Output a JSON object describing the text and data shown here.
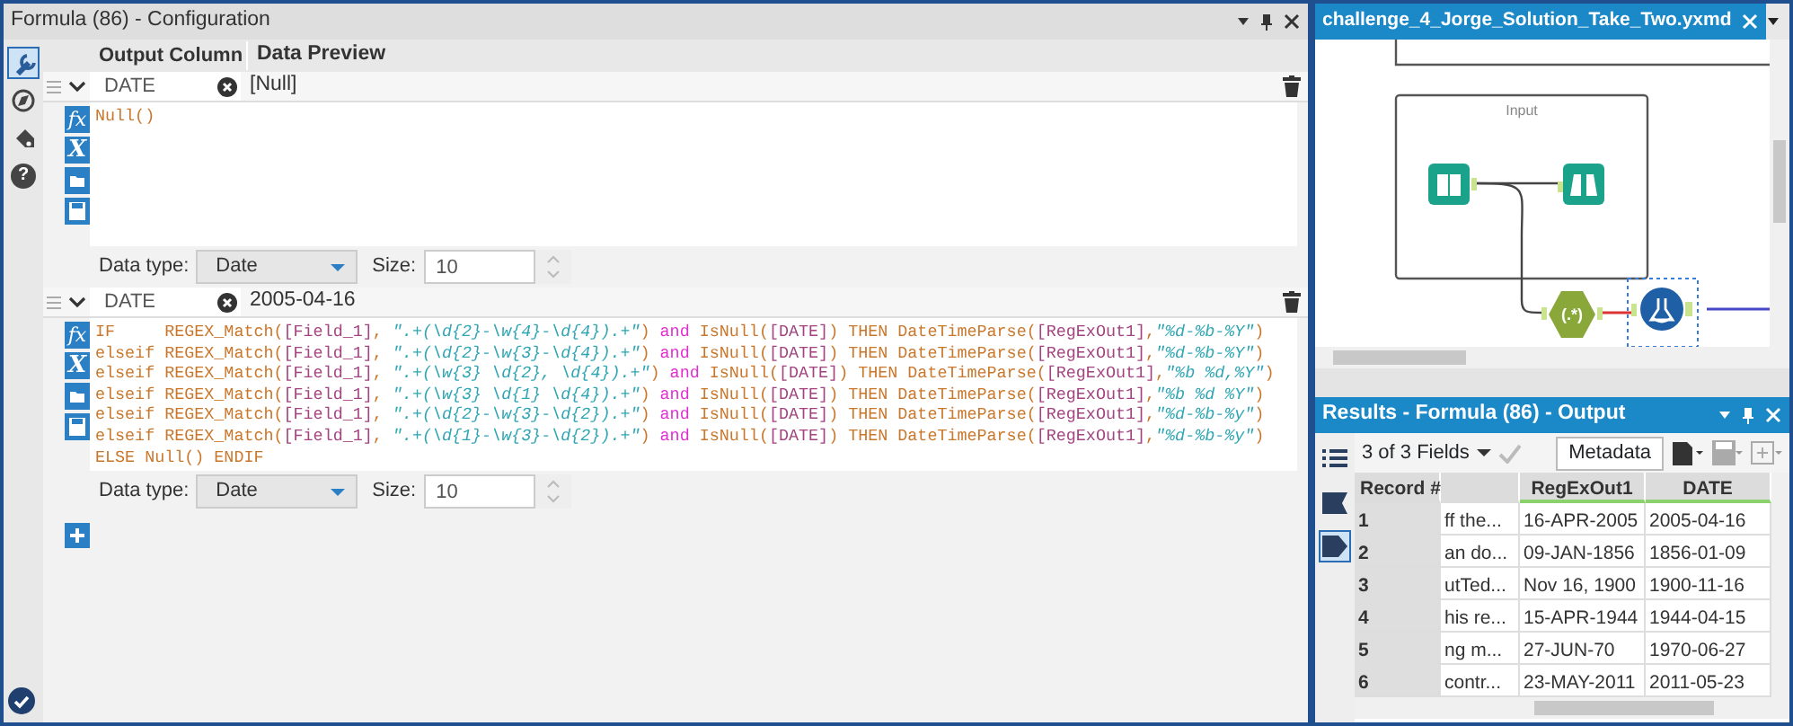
{
  "config_panel": {
    "title": "Formula (86) - Configuration",
    "tools": [
      {
        "kind": "wrench",
        "selected": true
      },
      {
        "kind": "compass",
        "selected": false
      },
      {
        "kind": "tag",
        "selected": false
      },
      {
        "kind": "help",
        "label": "?",
        "selected": false
      }
    ],
    "columns": [
      "Output Column",
      "Data Preview"
    ],
    "expressions": [
      {
        "expanded": true,
        "output_column": "DATE",
        "preview": "[Null]",
        "editor_buttons": [
          {
            "kind": "text",
            "label": "fx"
          },
          {
            "kind": "text",
            "label": "X"
          },
          {
            "kind": "folder"
          },
          {
            "kind": "save"
          }
        ],
        "lines": [
          [
            {
              "kind": "keyword",
              "text": "Null()"
            }
          ]
        ],
        "data_type_label": "Data type:",
        "data_type": "Date",
        "size_label": "Size:",
        "size": "10"
      },
      {
        "expanded": true,
        "output_column": "DATE",
        "preview": "2005-04-16",
        "editor_buttons": [
          {
            "kind": "text",
            "label": "fx"
          },
          {
            "kind": "text",
            "label": "X"
          },
          {
            "kind": "folder"
          },
          {
            "kind": "save"
          }
        ],
        "lines": [
          [
            {
              "kind": "keyword",
              "text": "IF     REGEX_Match("
            },
            {
              "kind": "field",
              "text": "[Field_1]"
            },
            {
              "kind": "keyword",
              "text": ", "
            },
            {
              "kind": "string",
              "text": "\".+(\\d{2}-\\w{4}-\\d{4}).+\""
            },
            {
              "kind": "keyword",
              "text": ")"
            },
            {
              "kind": "operator",
              "text": " and "
            },
            {
              "kind": "keyword",
              "text": "IsNull("
            },
            {
              "kind": "field",
              "text": "[DATE]"
            },
            {
              "kind": "keyword",
              "text": ") THEN DateTimeParse("
            },
            {
              "kind": "field",
              "text": "[RegExOut1]"
            },
            {
              "kind": "keyword",
              "text": ","
            },
            {
              "kind": "string",
              "text": "\"%d-%b-%Y\""
            },
            {
              "kind": "keyword",
              "text": ")"
            }
          ],
          [
            {
              "kind": "keyword",
              "text": "elseif REGEX_Match("
            },
            {
              "kind": "field",
              "text": "[Field_1]"
            },
            {
              "kind": "keyword",
              "text": ", "
            },
            {
              "kind": "string",
              "text": "\".+(\\d{2}-\\w{3}-\\d{4}).+\""
            },
            {
              "kind": "keyword",
              "text": ")"
            },
            {
              "kind": "operator",
              "text": " and "
            },
            {
              "kind": "keyword",
              "text": "IsNull("
            },
            {
              "kind": "field",
              "text": "[DATE]"
            },
            {
              "kind": "keyword",
              "text": ") THEN DateTimeParse("
            },
            {
              "kind": "field",
              "text": "[RegExOut1]"
            },
            {
              "kind": "keyword",
              "text": ","
            },
            {
              "kind": "string",
              "text": "\"%d-%b-%Y\""
            },
            {
              "kind": "keyword",
              "text": ")"
            }
          ],
          [
            {
              "kind": "keyword",
              "text": "elseif REGEX_Match("
            },
            {
              "kind": "field",
              "text": "[Field_1]"
            },
            {
              "kind": "keyword",
              "text": ", "
            },
            {
              "kind": "string",
              "text": "\".+(\\w{3} \\d{2}, \\d{4}).+\""
            },
            {
              "kind": "keyword",
              "text": ")"
            },
            {
              "kind": "operator",
              "text": " and "
            },
            {
              "kind": "keyword",
              "text": "IsNull("
            },
            {
              "kind": "field",
              "text": "[DATE]"
            },
            {
              "kind": "keyword",
              "text": ") THEN DateTimeParse("
            },
            {
              "kind": "field",
              "text": "[RegExOut1]"
            },
            {
              "kind": "keyword",
              "text": ","
            },
            {
              "kind": "string",
              "text": "\"%b %d,%Y\""
            },
            {
              "kind": "keyword",
              "text": ")"
            }
          ],
          [
            {
              "kind": "keyword",
              "text": "elseif REGEX_Match("
            },
            {
              "kind": "field",
              "text": "[Field_1]"
            },
            {
              "kind": "keyword",
              "text": ", "
            },
            {
              "kind": "string",
              "text": "\".+(\\w{3} \\d{1} \\d{4}).+\""
            },
            {
              "kind": "keyword",
              "text": ")"
            },
            {
              "kind": "operator",
              "text": " and "
            },
            {
              "kind": "keyword",
              "text": "IsNull("
            },
            {
              "kind": "field",
              "text": "[DATE]"
            },
            {
              "kind": "keyword",
              "text": ") THEN DateTimeParse("
            },
            {
              "kind": "field",
              "text": "[RegExOut1]"
            },
            {
              "kind": "keyword",
              "text": ","
            },
            {
              "kind": "string",
              "text": "\"%b %d %Y\""
            },
            {
              "kind": "keyword",
              "text": ")"
            }
          ],
          [
            {
              "kind": "keyword",
              "text": "elseif REGEX_Match("
            },
            {
              "kind": "field",
              "text": "[Field_1]"
            },
            {
              "kind": "keyword",
              "text": ", "
            },
            {
              "kind": "string",
              "text": "\".+(\\d{2}-\\w{3}-\\d{2}).+\""
            },
            {
              "kind": "keyword",
              "text": ")"
            },
            {
              "kind": "operator",
              "text": " and "
            },
            {
              "kind": "keyword",
              "text": "IsNull("
            },
            {
              "kind": "field",
              "text": "[DATE]"
            },
            {
              "kind": "keyword",
              "text": ") THEN DateTimeParse("
            },
            {
              "kind": "field",
              "text": "[RegExOut1]"
            },
            {
              "kind": "keyword",
              "text": ","
            },
            {
              "kind": "string",
              "text": "\"%d-%b-%y\""
            },
            {
              "kind": "keyword",
              "text": ")"
            }
          ],
          [
            {
              "kind": "keyword",
              "text": "elseif REGEX_Match("
            },
            {
              "kind": "field",
              "text": "[Field_1]"
            },
            {
              "kind": "keyword",
              "text": ", "
            },
            {
              "kind": "string",
              "text": "\".+(\\d{1}-\\w{3}-\\d{2}).+\""
            },
            {
              "kind": "keyword",
              "text": ")"
            },
            {
              "kind": "operator",
              "text": " and "
            },
            {
              "kind": "keyword",
              "text": "IsNull("
            },
            {
              "kind": "field",
              "text": "[DATE]"
            },
            {
              "kind": "keyword",
              "text": ") THEN DateTimeParse("
            },
            {
              "kind": "field",
              "text": "[RegExOut1]"
            },
            {
              "kind": "keyword",
              "text": ","
            },
            {
              "kind": "string",
              "text": "\"%d-%b-%y\""
            },
            {
              "kind": "keyword",
              "text": ")"
            }
          ],
          [
            {
              "kind": "keyword",
              "text": "ELSE Null() ENDIF"
            }
          ]
        ],
        "data_type_label": "Data type:",
        "data_type": "Date",
        "size_label": "Size:",
        "size": "10"
      }
    ]
  },
  "workflow": {
    "tab": "challenge_4_Jorge_Solution_Take_Two.yxmd",
    "container_title": "Input",
    "nodes": [
      {
        "kind": "book",
        "selected": false
      },
      {
        "kind": "binoculars",
        "selected": false
      },
      {
        "kind": "regex",
        "label": "(.*)",
        "selected": false
      },
      {
        "kind": "formula",
        "selected": true
      }
    ]
  },
  "results": {
    "title": "Results - Formula (86) - Output",
    "side_tools": [
      {
        "kind": "list",
        "selected": false
      },
      {
        "kind": "flag",
        "selected": false
      },
      {
        "kind": "tag",
        "selected": true
      }
    ],
    "fields_selector": "3 of 3 Fields",
    "metadata_button": "Metadata",
    "columns": [
      {
        "title": "Record #",
        "new": false
      },
      {
        "new": false
      },
      {
        "title": "RegExOut1",
        "new": true
      },
      {
        "title": "DATE",
        "new": true
      }
    ],
    "rows": [
      [
        "1",
        "ff the...",
        "16-APR-2005",
        "2005-04-16"
      ],
      [
        "2",
        "an do...",
        "09-JAN-1856",
        "1856-01-09"
      ],
      [
        "3",
        "utTed...",
        "Nov 16, 1900",
        "1900-11-16"
      ],
      [
        "4",
        "his re...",
        "15-APR-1944",
        "1944-04-15"
      ],
      [
        "5",
        "ng m...",
        "27-JUN-70",
        "1970-06-27"
      ],
      [
        "6",
        "contr...",
        "23-MAY-2011",
        "2011-05-23"
      ]
    ]
  }
}
